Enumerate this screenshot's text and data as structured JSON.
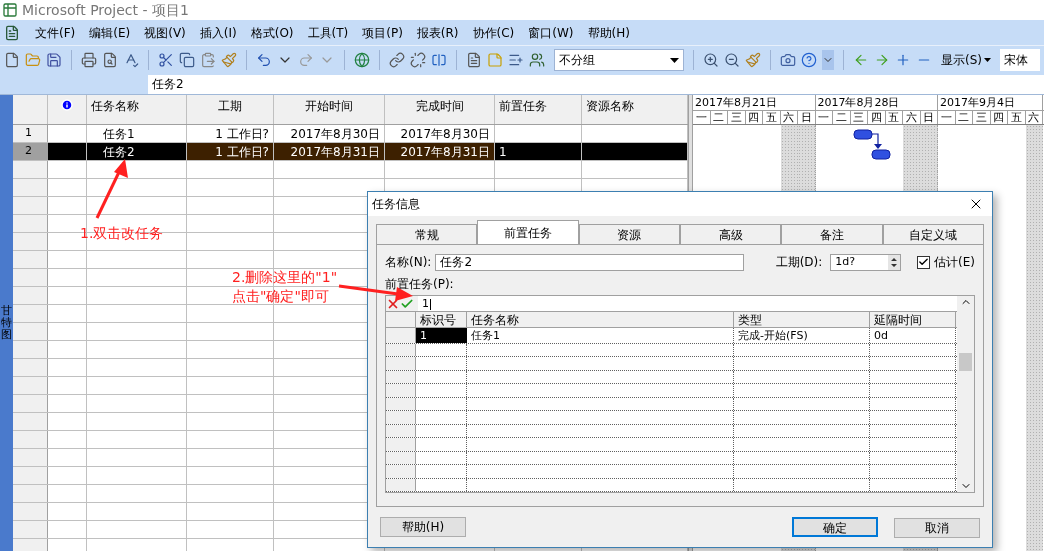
{
  "window": {
    "title": "Microsoft Project - 项目1"
  },
  "menu": [
    "文件(F)",
    "编辑(E)",
    "视图(V)",
    "插入(I)",
    "格式(O)",
    "工具(T)",
    "项目(P)",
    "报表(R)",
    "协作(C)",
    "窗口(W)",
    "帮助(H)"
  ],
  "toolbar": {
    "group_select": "不分组",
    "show_menu": "显示(S)",
    "font_select": "宋体"
  },
  "entry_bar": {
    "value": "任务2"
  },
  "view_bar": {
    "label": "甘特图"
  },
  "table": {
    "columns": [
      "任务名称",
      "工期",
      "开始时间",
      "完成时间",
      "前置任务",
      "资源名称"
    ],
    "rows": [
      {
        "id": "1",
        "name": "任务1",
        "duration": "1  工作日?",
        "start": "2017年8月30日",
        "finish": "2017年8月30日",
        "selected": false
      },
      {
        "id": "2",
        "name": "任务2",
        "duration": "1  工作日?",
        "start": "2017年8月31日",
        "finish": "2017年8月31日",
        "predecessors": "1",
        "selected": true
      }
    ]
  },
  "gantt": {
    "weeks": [
      {
        "label": "2017年8月21日",
        "days": [
          {
            "label": "一",
            "weekend": false
          },
          {
            "label": "二",
            "weekend": false
          },
          {
            "label": "三",
            "weekend": false
          },
          {
            "label": "四",
            "weekend": false
          },
          {
            "label": "五",
            "weekend": false
          },
          {
            "label": "六",
            "weekend": true
          },
          {
            "label": "日",
            "weekend": true
          }
        ]
      },
      {
        "label": "2017年8月28日",
        "days": [
          {
            "label": "一",
            "weekend": false
          },
          {
            "label": "二",
            "weekend": false
          },
          {
            "label": "三",
            "weekend": false
          },
          {
            "label": "四",
            "weekend": false
          },
          {
            "label": "五",
            "weekend": false
          },
          {
            "label": "六",
            "weekend": true
          },
          {
            "label": "日",
            "weekend": true
          }
        ]
      },
      {
        "label": "2017年9月4日",
        "days": [
          {
            "label": "一",
            "weekend": false
          },
          {
            "label": "二",
            "weekend": false
          },
          {
            "label": "三",
            "weekend": false
          },
          {
            "label": "四",
            "weekend": false
          },
          {
            "label": "五",
            "weekend": false
          },
          {
            "label": "六",
            "weekend": true
          }
        ]
      }
    ]
  },
  "dialog": {
    "title": "任务信息",
    "tabs": [
      {
        "label": "常规",
        "selected": false
      },
      {
        "label": "前置任务",
        "selected": true
      },
      {
        "label": "资源",
        "selected": false
      },
      {
        "label": "高级",
        "selected": false
      },
      {
        "label": "备注",
        "selected": false
      },
      {
        "label": "自定义域",
        "selected": false
      }
    ],
    "name_label": "名称(N):",
    "name_value": "任务2",
    "duration_label": "工期(D):",
    "duration_value": "1d?",
    "estimate": {
      "label": "估计(E)",
      "checked": true
    },
    "predecessors_label": "前置任务(P):",
    "entry_value": "1",
    "columns": [
      "标识号",
      "任务名称",
      "类型",
      "延隔时间"
    ],
    "rows": [
      {
        "id": "1",
        "name": "任务1",
        "type": "完成-开始(FS)",
        "lag": "0d"
      }
    ],
    "buttons": [
      {
        "label": "帮助(H)",
        "kind": "help",
        "default": false
      },
      {
        "label": "确定",
        "kind": "ok",
        "default": true
      },
      {
        "label": "取消",
        "kind": "cancel",
        "default": false
      }
    ]
  },
  "annotations": [
    {
      "lines": [
        "1.双击改任务"
      ]
    },
    {
      "lines": [
        "2.删除这里的\"1\"",
        "点击\"确定\"即可"
      ]
    }
  ]
}
